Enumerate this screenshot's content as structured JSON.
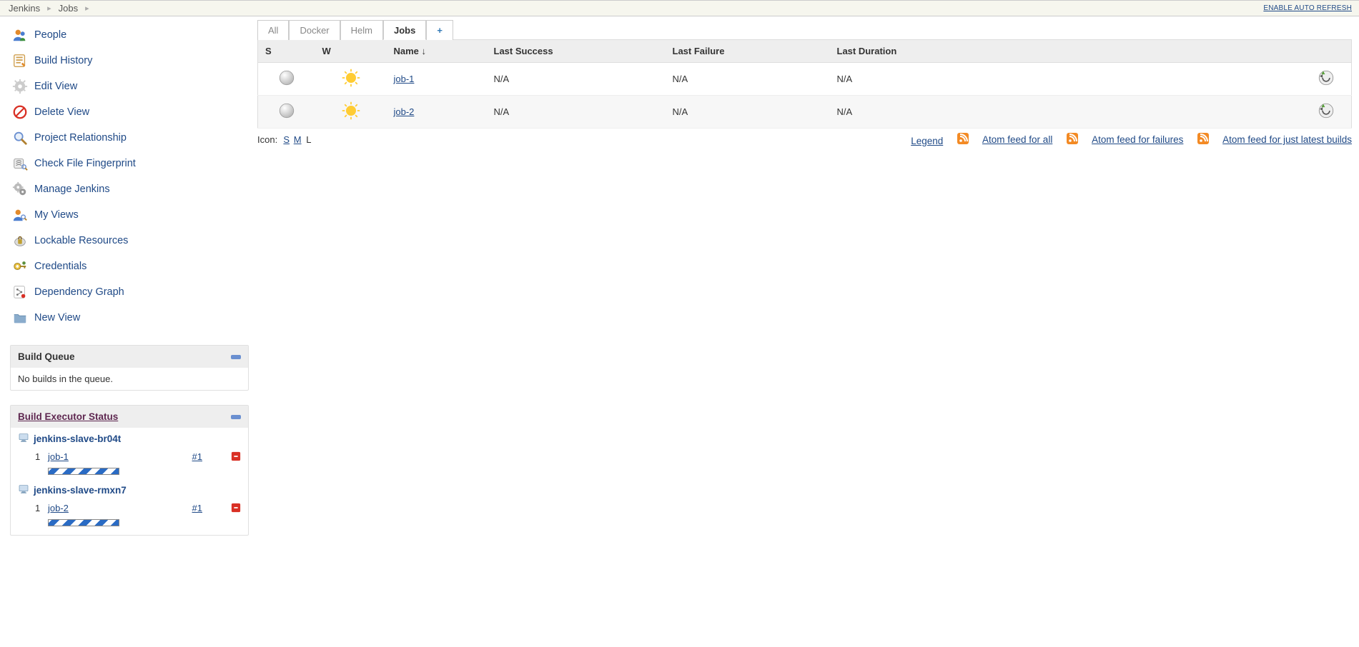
{
  "breadcrumbs": {
    "items": [
      {
        "label": "Jenkins"
      },
      {
        "label": "Jobs"
      }
    ],
    "auto_refresh": "ENABLE AUTO REFRESH"
  },
  "sidebar": {
    "tasks": [
      {
        "icon": "people-icon",
        "label": "People"
      },
      {
        "icon": "history-icon",
        "label": "Build History"
      },
      {
        "icon": "gear-icon",
        "label": "Edit View"
      },
      {
        "icon": "delete-icon",
        "label": "Delete View"
      },
      {
        "icon": "search-icon",
        "label": "Project Relationship"
      },
      {
        "icon": "fingerprint-icon",
        "label": "Check File Fingerprint"
      },
      {
        "icon": "manage-icon",
        "label": "Manage Jenkins"
      },
      {
        "icon": "myviews-icon",
        "label": "My Views"
      },
      {
        "icon": "lock-icon",
        "label": "Lockable Resources"
      },
      {
        "icon": "credentials-icon",
        "label": "Credentials"
      },
      {
        "icon": "depgraph-icon",
        "label": "Dependency Graph"
      },
      {
        "icon": "folder-icon",
        "label": "New View"
      }
    ],
    "queue": {
      "title": "Build Queue",
      "empty_text": "No builds in the queue."
    },
    "executors": {
      "title": "Build Executor Status",
      "nodes": [
        {
          "name": "jenkins-slave-br04t",
          "rows": [
            {
              "num": "1",
              "job": "job-1",
              "build": "#1"
            }
          ]
        },
        {
          "name": "jenkins-slave-rmxn7",
          "rows": [
            {
              "num": "1",
              "job": "job-2",
              "build": "#1"
            }
          ]
        }
      ]
    }
  },
  "main": {
    "tabs": [
      {
        "label": "All",
        "active": false
      },
      {
        "label": "Docker",
        "active": false
      },
      {
        "label": "Helm",
        "active": false
      },
      {
        "label": "Jobs",
        "active": true
      },
      {
        "label": "+",
        "active": false,
        "plus": true
      }
    ],
    "table": {
      "headers": {
        "s": "S",
        "w": "W",
        "name": "Name  ↓",
        "last_success": "Last Success",
        "last_failure": "Last Failure",
        "last_duration": "Last Duration"
      },
      "rows": [
        {
          "name": "job-1",
          "last_success": "N/A",
          "last_failure": "N/A",
          "last_duration": "N/A"
        },
        {
          "name": "job-2",
          "last_success": "N/A",
          "last_failure": "N/A",
          "last_duration": "N/A"
        }
      ]
    },
    "icon_row": {
      "label": "Icon:",
      "sizes": {
        "s": "S",
        "m": "M",
        "l": "L"
      }
    },
    "footer": {
      "legend": "Legend",
      "atom_all": "Atom feed for all",
      "atom_fail": "Atom feed for failures",
      "atom_latest": "Atom feed for just latest builds"
    }
  }
}
